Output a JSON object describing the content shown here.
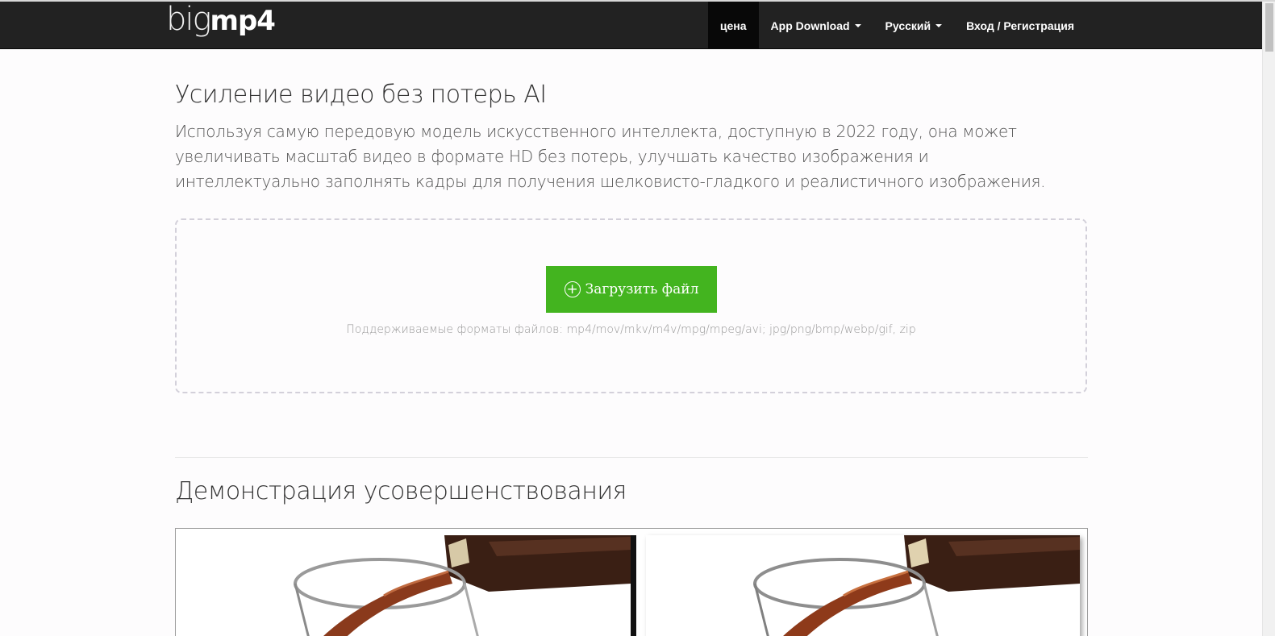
{
  "header": {
    "logo_big": "big",
    "logo_mp4": "mp4",
    "nav": [
      {
        "label": "цена",
        "dropdown": false,
        "active": true
      },
      {
        "label": "App Download",
        "dropdown": true,
        "active": false
      },
      {
        "label": "Русский",
        "dropdown": true,
        "active": false
      },
      {
        "label": "Вход / Регистрация",
        "dropdown": false,
        "active": false
      }
    ]
  },
  "main": {
    "title": "Усиление видео без потерь AI",
    "description": "Используя самую передовую модель искусственного интеллекта, доступную в 2022 году, она может увеличивать масштаб видео в формате HD без потерь, улучшать качество изображения и интеллектуально заполнять кадры для получения шелковисто-гладкого и реалистичного изображения.",
    "upload_button": "Загрузить файл",
    "supported_formats": "Поддерживаемые форматы файлов: mp4/mov/mkv/m4v/mpg/mpeg/avi; jpg/png/bmp/webp/gif, zip",
    "demo_title": "Демонстрация усовершенствования"
  },
  "colors": {
    "navbar_bg": "#222222",
    "upload_button_bg": "#43b41f",
    "page_bg": "#fdfcfd"
  }
}
